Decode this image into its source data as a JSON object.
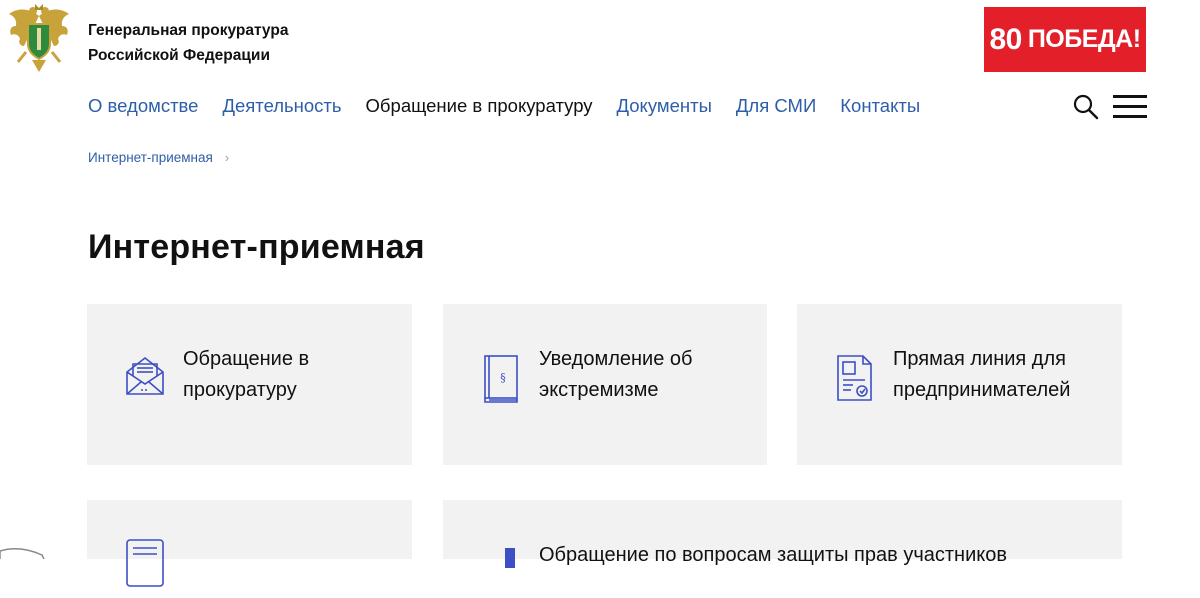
{
  "header": {
    "org_line1": "Генеральная прокуратура",
    "org_line2": "Российской Федерации",
    "logo_icon": "double-headed-eagle-emblem",
    "victory_number": "80",
    "victory_text": "ПОБЕДА!",
    "victory_color": "#e3202a"
  },
  "nav": {
    "items": [
      {
        "label": "О ведомстве"
      },
      {
        "label": "Деятельность"
      },
      {
        "label": "Обращение в прокуратуру"
      },
      {
        "label": "Документы"
      },
      {
        "label": "Для СМИ"
      },
      {
        "label": "Контакты"
      }
    ],
    "active_index": 2,
    "search_icon": "search-icon",
    "menu_icon": "hamburger-menu-icon"
  },
  "breadcrumb": {
    "items": [
      {
        "label": "Интернет-приемная"
      }
    ]
  },
  "page": {
    "title": "Интернет-приемная"
  },
  "cards": [
    {
      "line1": "Обращение в",
      "line2": "прокуратуру",
      "icon": "envelope-icon"
    },
    {
      "line1": "Уведомление об",
      "line2": "экстремизме",
      "icon": "law-book-icon"
    },
    {
      "line1": "Прямая линия для",
      "line2": "предпринимателей",
      "icon": "document-seal-icon"
    },
    {
      "line1": "",
      "line2": "",
      "icon": "form-document-icon"
    },
    {
      "line1": "Обращение по вопросам защиты прав участников",
      "line2": "",
      "icon": "bookmark-icon"
    }
  ],
  "colors": {
    "link": "#2e5ea8",
    "icon": "#3c4fc4",
    "card_bg": "#f2f2f2"
  }
}
